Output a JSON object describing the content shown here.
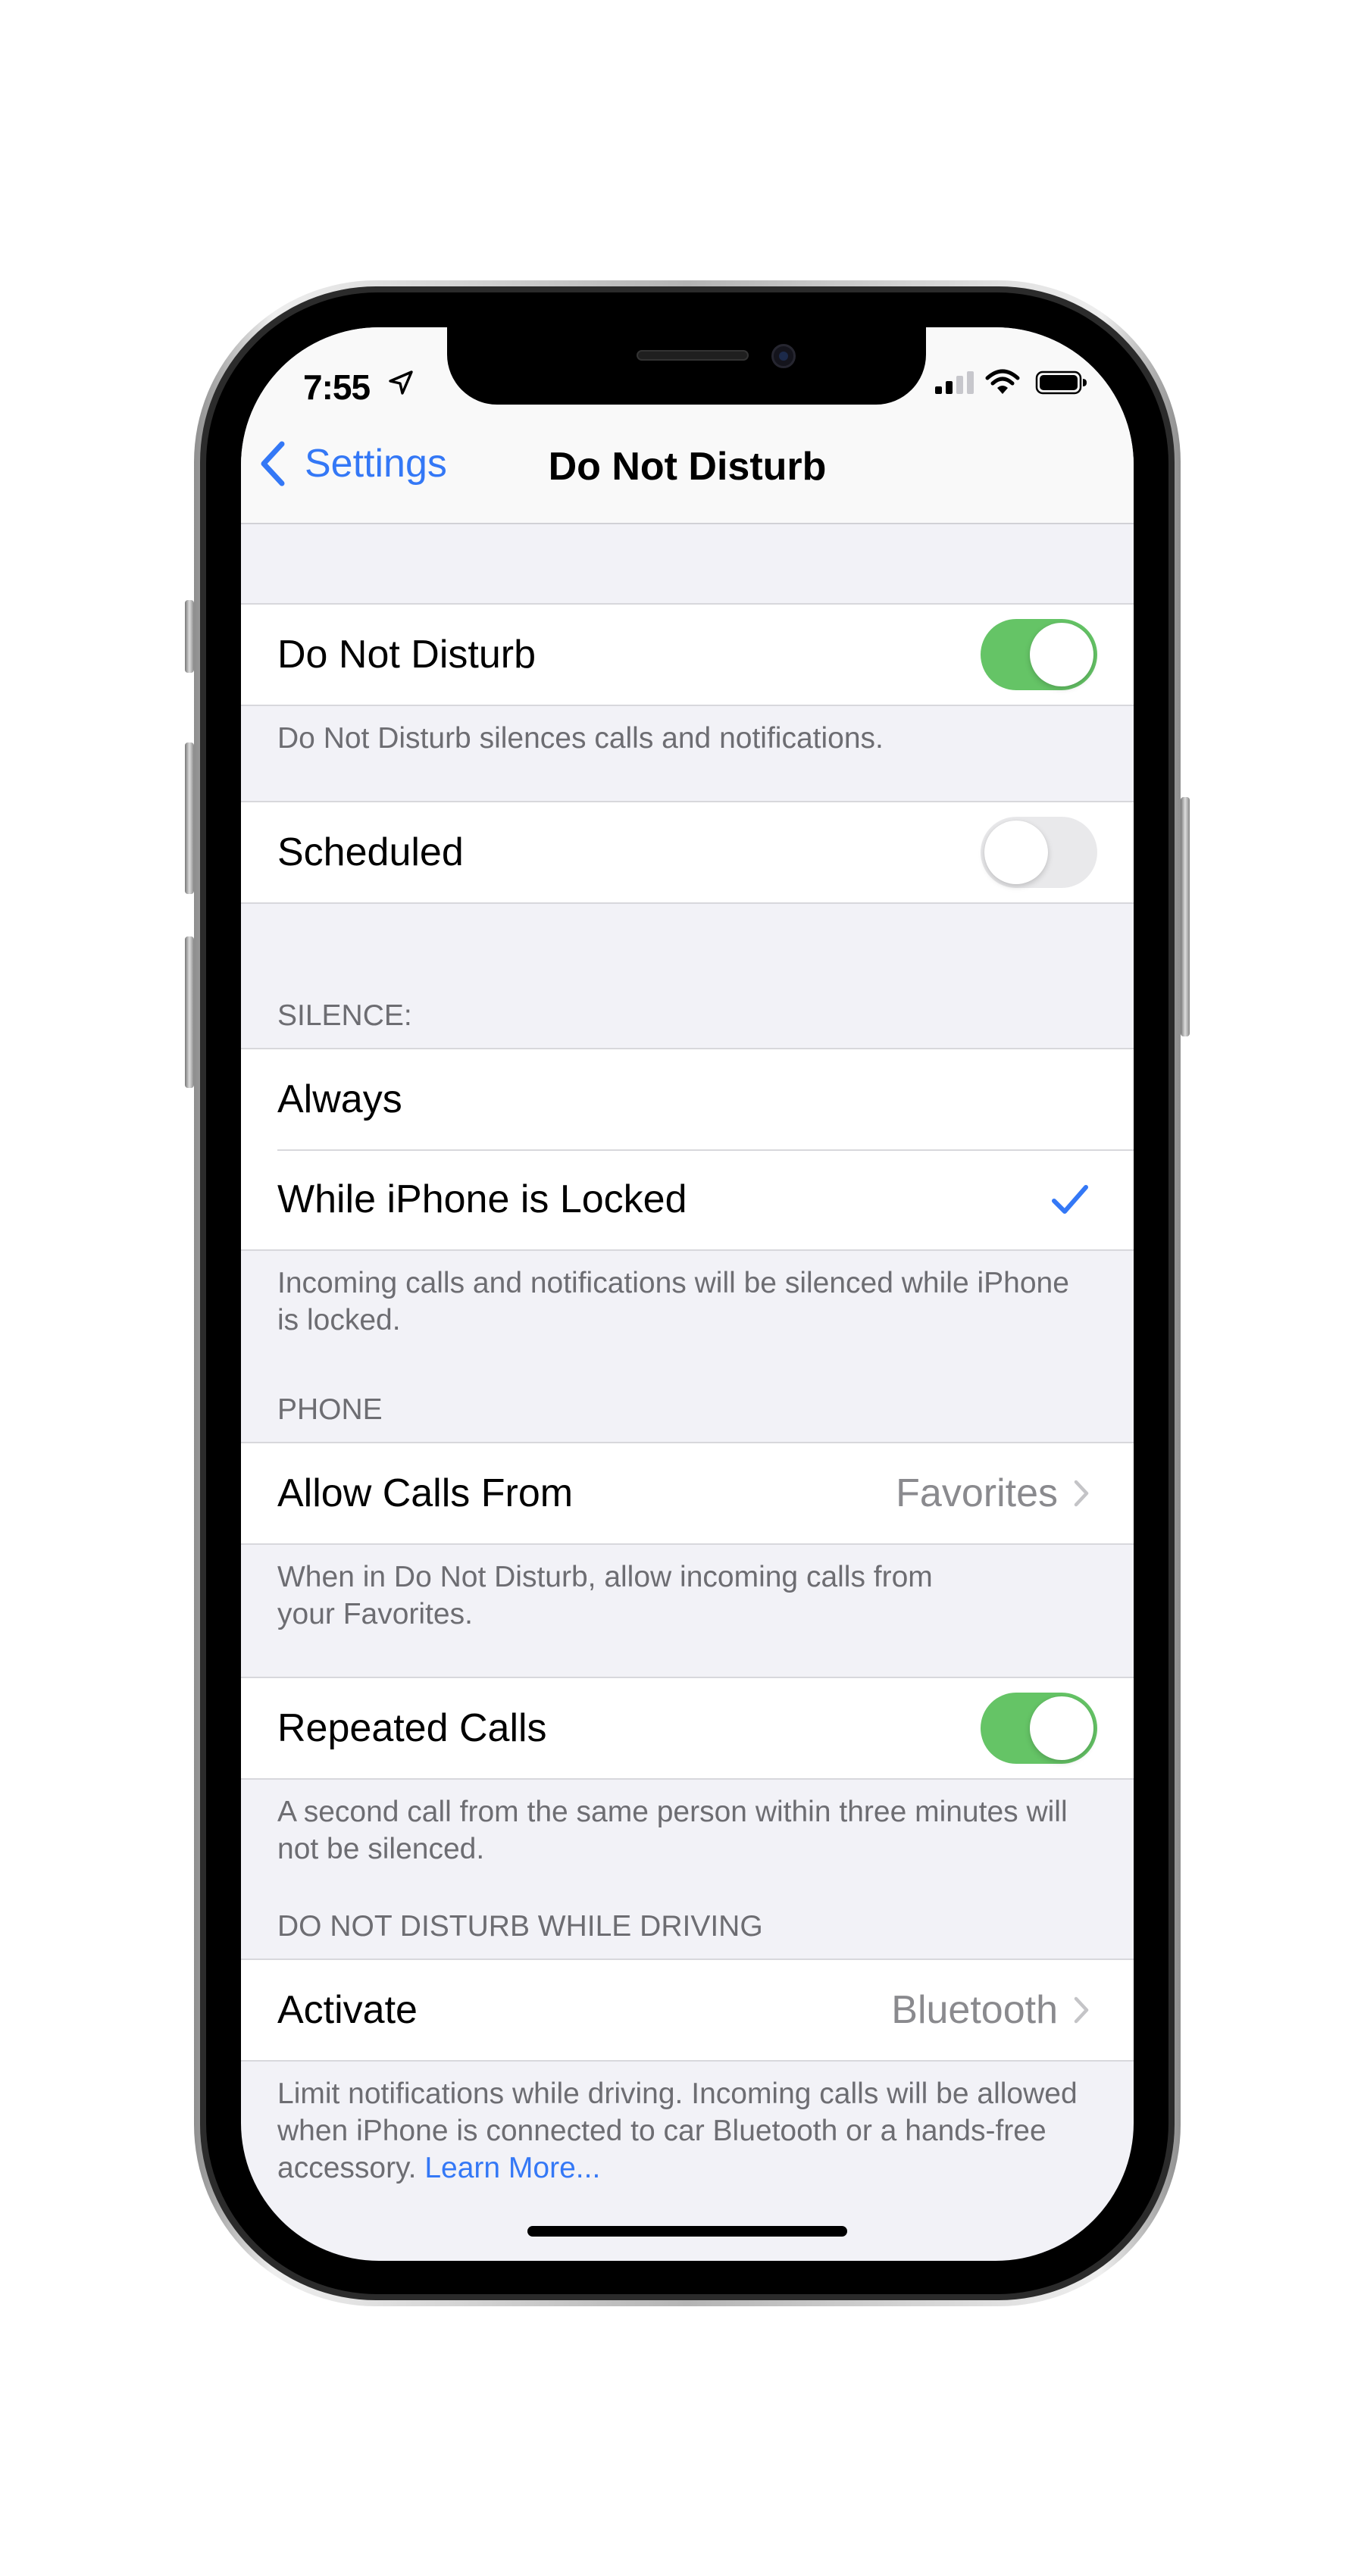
{
  "status_bar": {
    "time": "7:55",
    "location_icon": "location-arrow-icon",
    "signal_icon": "cellular-signal-icon",
    "wifi_icon": "wifi-icon",
    "battery_icon": "battery-full-icon"
  },
  "nav": {
    "back_label": "Settings",
    "title": "Do Not Disturb"
  },
  "sections": {
    "dnd": {
      "label": "Do Not Disturb",
      "toggle_on": true,
      "footer": "Do Not Disturb silences calls and notifications."
    },
    "scheduled": {
      "label": "Scheduled",
      "toggle_on": false
    },
    "silence": {
      "header": "SILENCE:",
      "options": [
        "Always",
        "While iPhone is Locked"
      ],
      "selected": "While iPhone is Locked",
      "footer": "Incoming calls and notifications will be silenced while iPhone is locked."
    },
    "phone": {
      "header": "PHONE",
      "allow_calls_label": "Allow Calls From",
      "allow_calls_value": "Favorites",
      "footer": "When in Do Not Disturb, allow incoming calls from your Favorites."
    },
    "repeated": {
      "label": "Repeated Calls",
      "toggle_on": true,
      "footer": "A second call from the same person within three minutes will not be silenced."
    },
    "driving": {
      "header": "DO NOT DISTURB WHILE DRIVING",
      "activate_label": "Activate",
      "activate_value": "Bluetooth",
      "footer": "Limit notifications while driving. Incoming calls will be allowed when iPhone is connected to car Bluetooth or a hands-free accessory.",
      "learn_more": "Learn More..."
    }
  },
  "colors": {
    "accent": "#3478f6",
    "toggle_on": "#65c466",
    "toggle_off": "#e9e9eb",
    "grouped_background": "#f2f2f7",
    "secondary_text": "#6d6d72"
  }
}
